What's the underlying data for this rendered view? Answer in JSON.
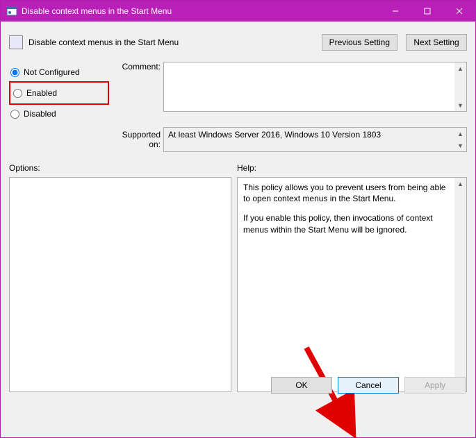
{
  "window": {
    "title": "Disable context menus in the Start Menu",
    "minimize_tooltip": "Minimize",
    "maximize_tooltip": "Maximize",
    "close_tooltip": "Close"
  },
  "header": {
    "title": "Disable context menus in the Start Menu",
    "prev_label": "Previous Setting",
    "next_label": "Next Setting"
  },
  "state": {
    "not_configured_label": "Not Configured",
    "enabled_label": "Enabled",
    "disabled_label": "Disabled",
    "selected": "not_configured"
  },
  "labels": {
    "comment": "Comment:",
    "supported_on": "Supported on:",
    "options": "Options:",
    "help": "Help:"
  },
  "comment_value": "",
  "supported_on_value": "At least Windows Server 2016, Windows 10 Version 1803",
  "options_value": "",
  "help_paragraphs": [
    "This policy allows you to prevent users from being able to open context menus in the Start Menu.",
    "If you enable this policy, then invocations of context menus within the Start Menu will be ignored."
  ],
  "footer": {
    "ok": "OK",
    "cancel": "Cancel",
    "apply": "Apply"
  },
  "annotations": {
    "highlight_enabled_radio": true,
    "arrow_points_to": "ok-button"
  }
}
